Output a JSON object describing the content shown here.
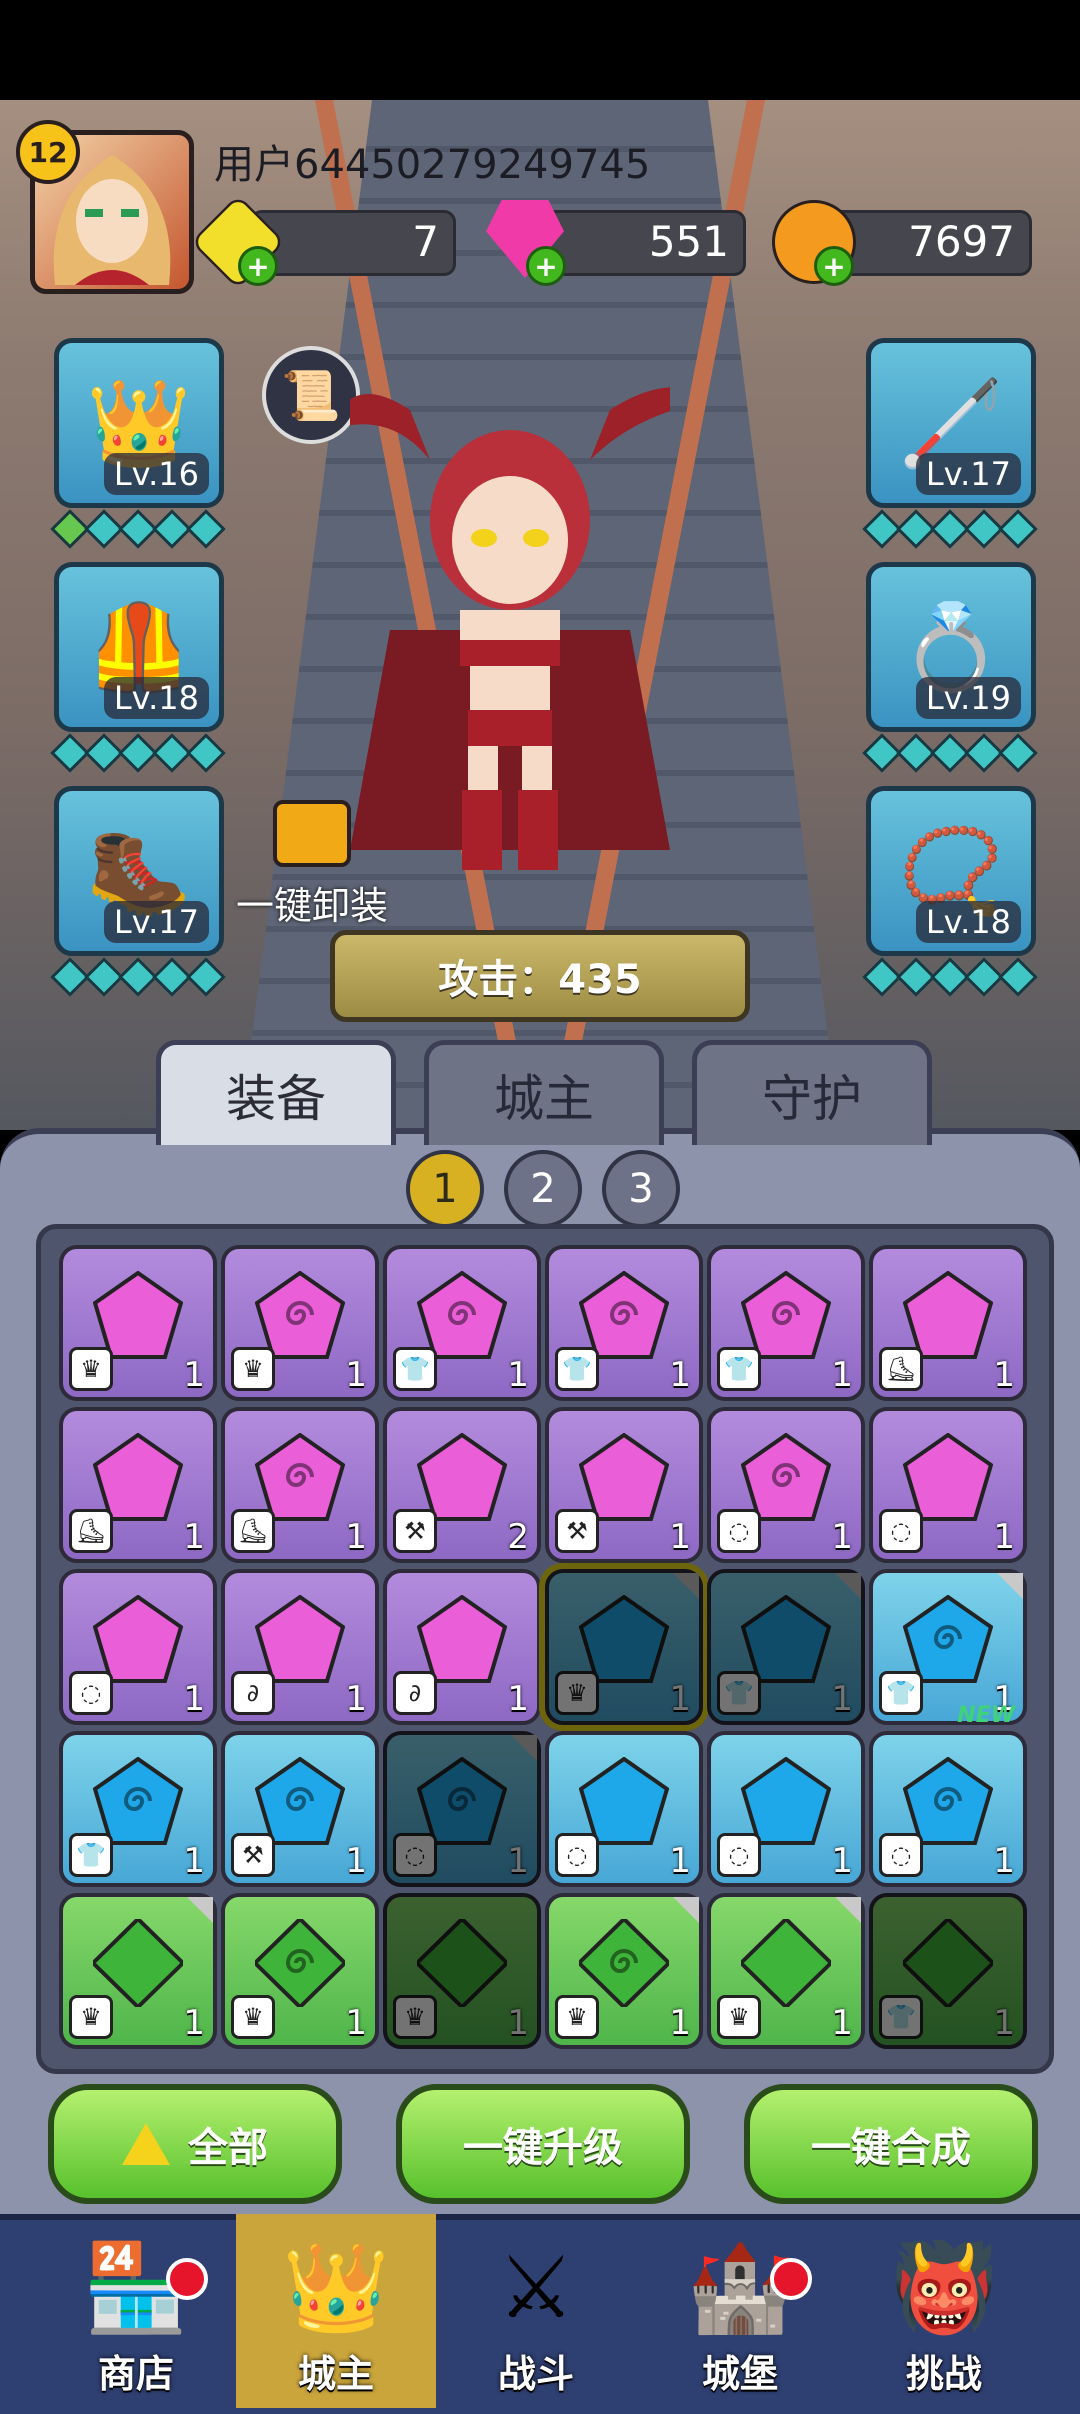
{
  "player": {
    "level": "12",
    "name": "用户64450279249745"
  },
  "resources": [
    {
      "name": "gold-coin",
      "value": "7",
      "color": "#f1df2c"
    },
    {
      "name": "pink-gem",
      "value": "551",
      "color": "#ef3aa8"
    },
    {
      "name": "orange-coin",
      "value": "7697",
      "color": "#f39a1f"
    }
  ],
  "equipment_slots": {
    "left": [
      {
        "icon": "crown-icon",
        "level": "Lv.16"
      },
      {
        "icon": "armor-icon",
        "level": "Lv.18"
      },
      {
        "icon": "boots-icon",
        "level": "Lv.17"
      }
    ],
    "right": [
      {
        "icon": "staff-icon",
        "level": "Lv.17"
      },
      {
        "icon": "ring-icon",
        "level": "Lv.19"
      },
      {
        "icon": "amulet-icon",
        "level": "Lv.18"
      }
    ]
  },
  "unequip_all_label": "一键卸装",
  "attack_label": "攻击：435",
  "tabs": [
    "装备",
    "城主",
    "守护"
  ],
  "pages": [
    "1",
    "2",
    "3"
  ],
  "gem_grid": [
    [
      {
        "color": "purple",
        "shape": "plain",
        "slot": "crown",
        "count": "1"
      },
      {
        "color": "purple",
        "shape": "swirl",
        "slot": "crown",
        "count": "1"
      },
      {
        "color": "purple",
        "shape": "swirl",
        "slot": "armor",
        "count": "1"
      },
      {
        "color": "purple",
        "shape": "swirl",
        "slot": "armor",
        "count": "1"
      },
      {
        "color": "purple",
        "shape": "swirl",
        "slot": "armor",
        "count": "1"
      },
      {
        "color": "purple",
        "shape": "plain",
        "slot": "boots",
        "count": "1"
      }
    ],
    [
      {
        "color": "purple",
        "shape": "plain",
        "slot": "boots",
        "count": "1"
      },
      {
        "color": "purple",
        "shape": "swirl",
        "slot": "boots",
        "count": "1"
      },
      {
        "color": "purple",
        "shape": "plain",
        "slot": "staff",
        "count": "2"
      },
      {
        "color": "purple",
        "shape": "plain",
        "slot": "staff",
        "count": "1"
      },
      {
        "color": "purple",
        "shape": "swirl",
        "slot": "ring",
        "count": "1"
      },
      {
        "color": "purple",
        "shape": "plain",
        "slot": "ring",
        "count": "1"
      }
    ],
    [
      {
        "color": "purple",
        "shape": "plain",
        "slot": "ring",
        "count": "1"
      },
      {
        "color": "purple",
        "shape": "plain",
        "slot": "amulet",
        "count": "1"
      },
      {
        "color": "purple",
        "shape": "plain",
        "slot": "amulet",
        "count": "1"
      },
      {
        "color": "blue",
        "shape": "plain",
        "slot": "crown",
        "count": "1",
        "dim": true,
        "selected": true,
        "corner": true
      },
      {
        "color": "blue",
        "shape": "plain",
        "slot": "armor",
        "count": "1",
        "dim": true,
        "corner": true
      },
      {
        "color": "blue",
        "shape": "swirl",
        "slot": "armor",
        "count": "1",
        "corner": true
      }
    ],
    [
      {
        "color": "blue",
        "shape": "swirl",
        "slot": "armor",
        "count": "1"
      },
      {
        "color": "blue",
        "shape": "swirl",
        "slot": "staff",
        "count": "1"
      },
      {
        "color": "blue",
        "shape": "swirl",
        "slot": "ring",
        "count": "1",
        "dim": true,
        "corner": true
      },
      {
        "color": "blue",
        "shape": "plain",
        "slot": "ring",
        "count": "1"
      },
      {
        "color": "blue",
        "shape": "plain",
        "slot": "ring",
        "count": "1"
      },
      {
        "color": "blue",
        "shape": "swirl",
        "slot": "ring",
        "count": "1",
        "new": "NEW"
      }
    ],
    [
      {
        "color": "green",
        "shape": "plain",
        "slot": "crown",
        "count": "1",
        "corner": true
      },
      {
        "color": "green",
        "shape": "swirl",
        "slot": "crown",
        "count": "1"
      },
      {
        "color": "green",
        "shape": "plain",
        "slot": "crown",
        "count": "1",
        "dim": true
      },
      {
        "color": "green",
        "shape": "swirl",
        "slot": "crown",
        "count": "1",
        "corner": true
      },
      {
        "color": "green",
        "shape": "plain",
        "slot": "crown",
        "count": "1",
        "corner": true
      },
      {
        "color": "green",
        "shape": "plain",
        "slot": "armor",
        "count": "1",
        "dim": true
      }
    ]
  ],
  "actions": {
    "all": "全部",
    "upgrade": "一键升级",
    "merge": "一键合成"
  },
  "nav": [
    {
      "label": "商店",
      "icon": "shop-icon",
      "badge": true
    },
    {
      "label": "城主",
      "icon": "crown-icon",
      "active": true
    },
    {
      "label": "战斗",
      "icon": "swords-icon"
    },
    {
      "label": "城堡",
      "icon": "castle-icon",
      "badge": true
    },
    {
      "label": "挑战",
      "icon": "demon-icon"
    }
  ]
}
